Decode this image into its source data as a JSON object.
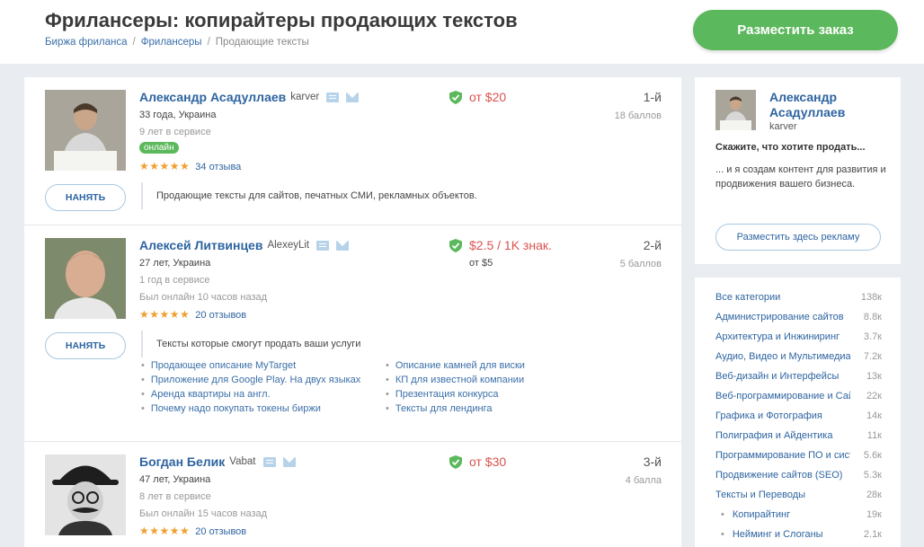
{
  "header": {
    "title": "Фрилансеры: копирайтеры продающих текстов",
    "breadcrumb": [
      "Биржа фриланса",
      "Фрилансеры",
      "Продающие тексты"
    ],
    "order_button": "Разместить заказ"
  },
  "freelancers": [
    {
      "name": "Александр Асадуллаев",
      "login": "karver",
      "age": "33 года, Украина",
      "service": "9 лет в сервисе",
      "online": "онлайн",
      "reviews": "34 отзыва",
      "price": "от $20",
      "rank": "1-й",
      "score": "18 баллов",
      "hire": "НАНЯТЬ",
      "description": "Продающие тексты для сайтов, печатных СМИ, рекламных объектов."
    },
    {
      "name": "Алексей Литвинцев",
      "login": "AlexeyLit",
      "age": "27 лет, Украина",
      "service": "1 год в сервисе",
      "last_online": "Был онлайн 10 часов назад",
      "reviews": "20 отзывов",
      "price": "$2.5 / 1K знак.",
      "price_sub": "от $5",
      "rank": "2-й",
      "score": "5 баллов",
      "hire": "НАНЯТЬ",
      "description": "Тексты которые смогут продать ваши услуги",
      "portfolio_left": [
        "Продающее описание MyTarget",
        "Приложение для Google Play. На двух языках",
        "Аренда квартиры на англ.",
        "Почему надо покупать токены биржи"
      ],
      "portfolio_right": [
        "Описание камней для виски",
        "КП для известной компании",
        "Презентация конкурса",
        "Тексты для лендинга"
      ]
    },
    {
      "name": "Богдан Белик",
      "login": "Vabat",
      "age": "47 лет, Украина",
      "service": "8 лет в сервисе",
      "last_online": "Был онлайн 15 часов назад",
      "reviews": "20 отзывов",
      "price": "от $30",
      "rank": "3-й",
      "score": "4 балла"
    }
  ],
  "promo": {
    "name": "Александр Асадуллаев",
    "login": "karver",
    "heading": "Скажите, что хотите продать...",
    "text": "... и я создам контент для развития и продвижения вашего бизнеса.",
    "button": "Разместить здесь рекламу"
  },
  "categories": [
    {
      "label": "Все категории",
      "count": "138к"
    },
    {
      "label": "Администрирование сайтов",
      "count": "8.8к"
    },
    {
      "label": "Архитектура и Инжиниринг",
      "count": "3.7к"
    },
    {
      "label": "Аудио, Видео и Мультимедиа",
      "count": "7.2к"
    },
    {
      "label": "Веб-дизайн и Интерфейсы",
      "count": "13к"
    },
    {
      "label": "Веб-программирование и Сайты",
      "count": "22к"
    },
    {
      "label": "Графика и Фотография",
      "count": "14к"
    },
    {
      "label": "Полиграфия и Айдентика",
      "count": "11к"
    },
    {
      "label": "Программирование ПО и систем",
      "count": "5.6к"
    },
    {
      "label": "Продвижение сайтов (SEO)",
      "count": "5.3к"
    },
    {
      "label": "Тексты и Переводы",
      "count": "28к"
    },
    {
      "label": "Копирайтинг",
      "count": "19к"
    },
    {
      "label": "Нейминг и Слоганы",
      "count": "2.1к"
    }
  ],
  "colors": {
    "accent": "#5cb85c",
    "link": "#2e64a0",
    "price": "#d9534f",
    "stars": "#f0a030"
  }
}
